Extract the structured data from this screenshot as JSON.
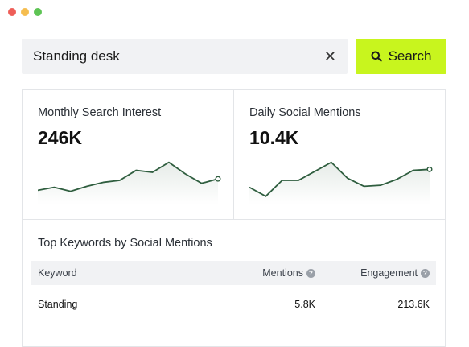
{
  "window": {
    "controls": {
      "close_color": "#ee5e58",
      "minimize_color": "#f5bd4f",
      "maximize_color": "#5ec454"
    }
  },
  "search": {
    "value": "Standing desk",
    "clear_icon": "close-icon",
    "button_label": "Search",
    "button_icon": "search-icon",
    "button_color": "#c8f51e"
  },
  "metrics": [
    {
      "label": "Monthly Search Interest",
      "value": "246K",
      "trend": [
        0.22,
        0.28,
        0.2,
        0.3,
        0.38,
        0.42,
        0.62,
        0.58,
        0.78,
        0.55,
        0.36,
        0.45
      ]
    },
    {
      "label": "Daily Social Mentions",
      "value": "10.4K",
      "trend": [
        0.28,
        0.1,
        0.42,
        0.42,
        0.6,
        0.78,
        0.46,
        0.3,
        0.32,
        0.44,
        0.62,
        0.64
      ]
    }
  ],
  "accent_color": "#2f5e3f",
  "keywords": {
    "title": "Top Keywords by Social Mentions",
    "headers": {
      "keyword": "Keyword",
      "mentions": "Mentions",
      "engagement": "Engagement"
    },
    "help_icon": "question-mark-icon",
    "rows": [
      {
        "keyword": "Standing",
        "mentions": "5.8K",
        "engagement": "213.6K"
      }
    ]
  }
}
